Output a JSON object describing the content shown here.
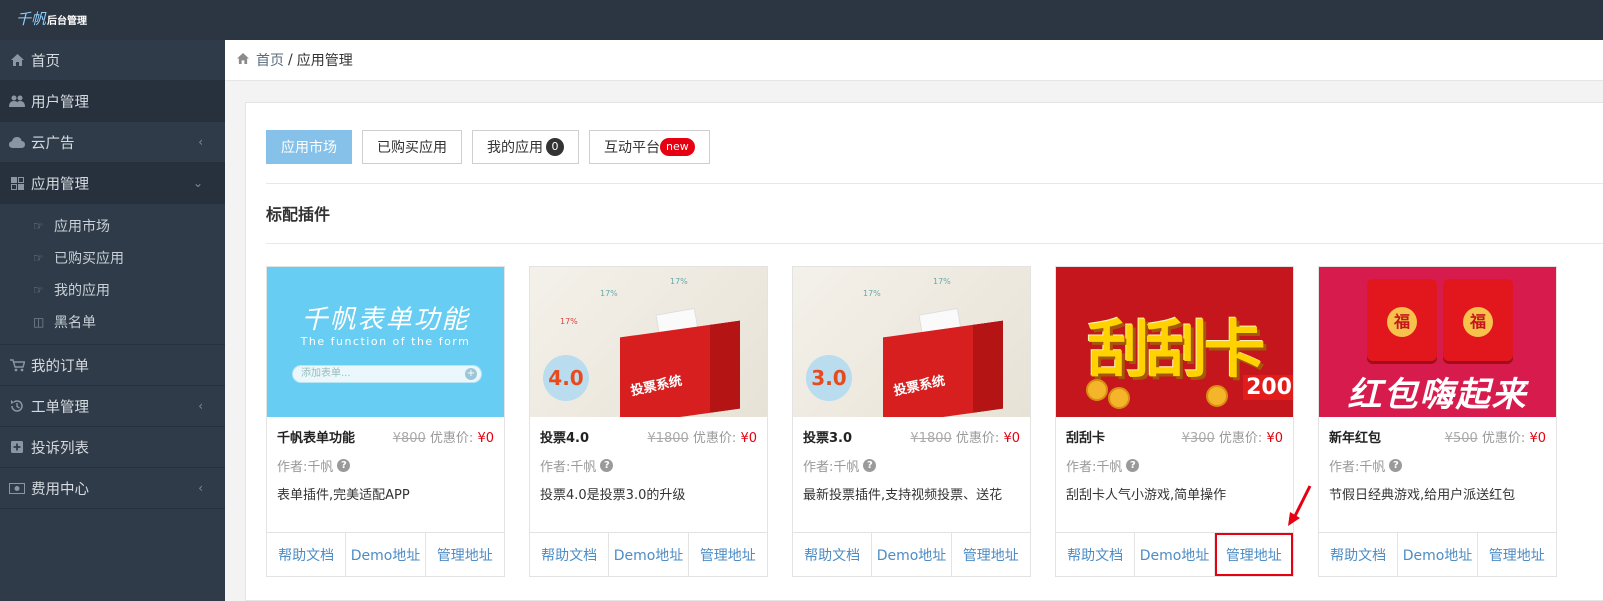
{
  "topbar": {
    "logo_script": "千帆",
    "logo_text": "后台管理"
  },
  "sidebar": {
    "items": [
      {
        "label": "首页",
        "icon": "home-icon"
      },
      {
        "label": "用户管理",
        "icon": "users-icon"
      },
      {
        "label": "云广告",
        "icon": "cloud-icon"
      },
      {
        "label": "应用管理",
        "icon": "apps-icon"
      },
      {
        "label": "我的订单",
        "icon": "cart-icon"
      },
      {
        "label": "工单管理",
        "icon": "history-icon"
      },
      {
        "label": "投诉列表",
        "icon": "plus-square-icon"
      },
      {
        "label": "费用中心",
        "icon": "money-icon"
      }
    ],
    "submenu": [
      {
        "label": "应用市场",
        "icon": "hand-point-icon"
      },
      {
        "label": "已购买应用",
        "icon": "hand-point-icon"
      },
      {
        "label": "我的应用",
        "icon": "hand-point-icon"
      },
      {
        "label": "黑名单",
        "icon": "columns-icon"
      }
    ]
  },
  "breadcrumb": {
    "home": "首页",
    "separator": "/",
    "current": "应用管理"
  },
  "tabs": [
    {
      "label": "应用市场",
      "active": true
    },
    {
      "label": "已购买应用"
    },
    {
      "label": "我的应用",
      "badge": "0"
    },
    {
      "label": "互动平台",
      "badge": "new"
    }
  ],
  "section_title": "标配插件",
  "cards": [
    {
      "title": "千帆表单功能",
      "old_price": "¥800",
      "price_label": "优惠价:",
      "price": "¥0",
      "author": "作者:千帆",
      "desc": "表单插件,完美适配APP",
      "thumb_text": "千帆表单功能",
      "thumb_sub": "The function of the form",
      "thumb_input": "添加表单...",
      "links": [
        "帮助文档",
        "Demo地址",
        "管理地址"
      ]
    },
    {
      "title": "投票4.0",
      "old_price": "¥1800",
      "price_label": "优惠价:",
      "price": "¥0",
      "author": "作者:千帆",
      "desc": "投票4.0是投票3.0的升级",
      "thumb_badge": "4.0",
      "thumb_box": "投票系统",
      "links": [
        "帮助文档",
        "Demo地址",
        "管理地址"
      ]
    },
    {
      "title": "投票3.0",
      "old_price": "¥1800",
      "price_label": "优惠价:",
      "price": "¥0",
      "author": "作者:千帆",
      "desc": "最新投票插件,支持视频投票、送花",
      "thumb_badge": "3.0",
      "thumb_box": "投票系统",
      "links": [
        "帮助文档",
        "Demo地址",
        "管理地址"
      ]
    },
    {
      "title": "刮刮卡",
      "old_price": "¥300",
      "price_label": "优惠价:",
      "price": "¥0",
      "author": "作者:千帆",
      "desc": "刮刮卡人气小游戏,简单操作",
      "thumb_text": "刮刮卡",
      "thumb_num": "200",
      "links": [
        "帮助文档",
        "Demo地址",
        "管理地址"
      ]
    },
    {
      "title": "新年红包",
      "old_price": "¥500",
      "price_label": "优惠价:",
      "price": "¥0",
      "author": "作者:千帆",
      "desc": "节假日经典游戏,给用户派送红包",
      "thumb_text": "红包嗨起来",
      "thumb_fu": "福",
      "links": [
        "帮助文档",
        "Demo地址",
        "管理地址"
      ]
    }
  ],
  "stat_label": "17%",
  "colors": {
    "topbar": "#2c3542",
    "sidebar": "#2f3b48",
    "accent": "#86c1ea",
    "link": "#4d8cc4",
    "price": "#e60012"
  }
}
